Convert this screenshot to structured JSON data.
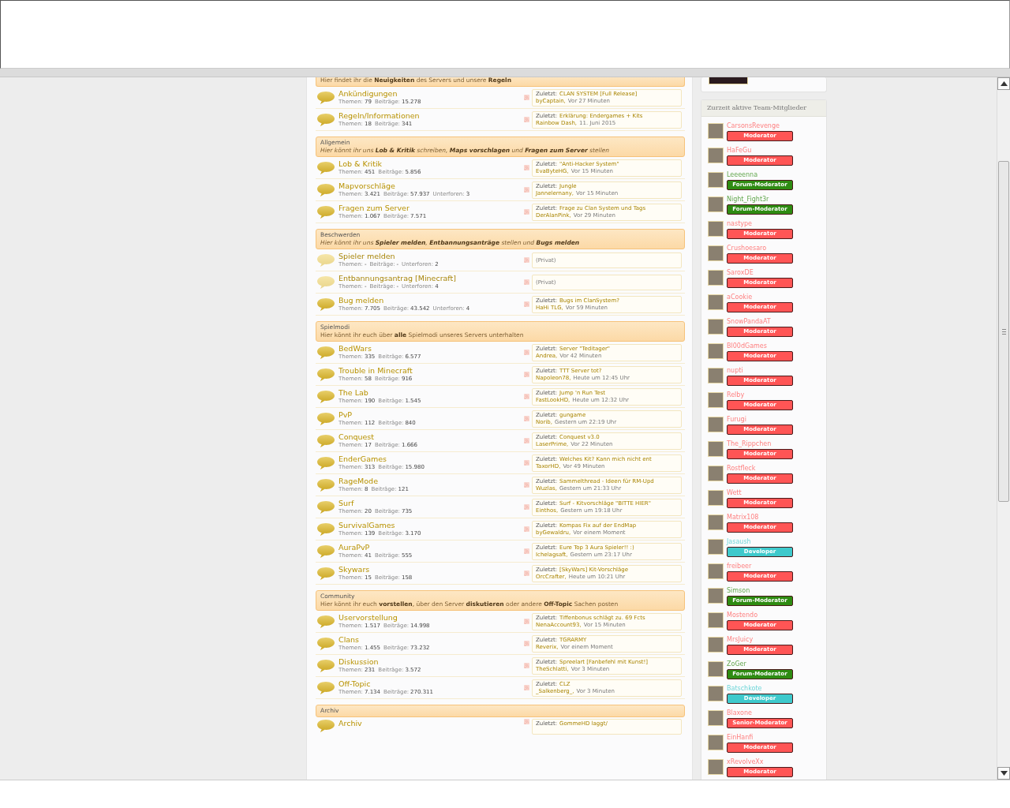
{
  "forum": {
    "sections": [
      {
        "description": "Hier findet ihr die **Neuigkeiten** des Servers und unsere **Regeln**",
        "italic": false,
        "forums": [
          {
            "name": "Ankündigungen",
            "unread": true,
            "stats": [
              {
                "label": "Themen:",
                "value": "79"
              },
              {
                "label": "Beiträge:",
                "value": "15.278"
              }
            ],
            "last": {
              "label": "Zuletzt:",
              "title": "CLAN SYSTEM [Full Release]",
              "author": "byCaptain,",
              "time": "Vor 27 Minuten"
            }
          },
          {
            "name": "Regeln/Informationen",
            "unread": true,
            "stats": [
              {
                "label": "Themen:",
                "value": "18"
              },
              {
                "label": "Beiträge:",
                "value": "341"
              }
            ],
            "last": {
              "label": "Zuletzt:",
              "title": "Erklärung: Endergames + Kits",
              "author": "Rainbow Dash,",
              "time": "11. Juni 2015"
            }
          }
        ]
      },
      {
        "title": "Allgemein",
        "description": "Hier könnt ihr uns **Lob & Kritik** schreiben, **Maps vorschlagen** und **Fragen zum Server** stellen",
        "italic": true,
        "forums": [
          {
            "name": "Lob & Kritik",
            "unread": true,
            "stats": [
              {
                "label": "Themen:",
                "value": "451"
              },
              {
                "label": "Beiträge:",
                "value": "5.856"
              }
            ],
            "last": {
              "label": "Zuletzt:",
              "title": "\"Anti-Hacker System\"",
              "author": "EvaByteHG,",
              "time": "Vor 15 Minuten"
            }
          },
          {
            "name": "Mapvorschläge",
            "unread": true,
            "stats": [
              {
                "label": "Themen:",
                "value": "3.421"
              },
              {
                "label": "Beiträge:",
                "value": "57.937"
              },
              {
                "label": "Unterforen:",
                "value": "3"
              }
            ],
            "last": {
              "label": "Zuletzt:",
              "title": "Jungle",
              "author": "Jannelernany,",
              "time": "Vor 15 Minuten"
            }
          },
          {
            "name": "Fragen zum Server",
            "unread": true,
            "stats": [
              {
                "label": "Themen:",
                "value": "1.067"
              },
              {
                "label": "Beiträge:",
                "value": "7.571"
              }
            ],
            "last": {
              "label": "Zuletzt:",
              "title": "Frage zu Clan System und Tags",
              "author": "DerAlanPink,",
              "time": "Vor 29 Minuten"
            }
          }
        ]
      },
      {
        "title": "Beschwerden",
        "description": "Hier könnt ihr uns **Spieler melden**, **Entbannungsanträge** stellen und **Bugs melden**",
        "italic": true,
        "forums": [
          {
            "name": "Spieler melden",
            "unread": false,
            "stats": [
              {
                "label": "Themen:",
                "value": "-"
              },
              {
                "label": "Beiträge:",
                "value": "-"
              },
              {
                "label": "Unterforen:",
                "value": "2"
              }
            ],
            "last": {
              "private": "(Privat)"
            }
          },
          {
            "name": "Entbannungsantrag [Minecraft]",
            "unread": false,
            "stats": [
              {
                "label": "Themen:",
                "value": "-"
              },
              {
                "label": "Beiträge:",
                "value": "-"
              },
              {
                "label": "Unterforen:",
                "value": "4"
              }
            ],
            "last": {
              "private": "(Privat)"
            }
          },
          {
            "name": "Bug melden",
            "unread": true,
            "stats": [
              {
                "label": "Themen:",
                "value": "7.705"
              },
              {
                "label": "Beiträge:",
                "value": "43.542"
              },
              {
                "label": "Unterforen:",
                "value": "4"
              }
            ],
            "last": {
              "label": "Zuletzt:",
              "title": "Bugs im ClanSystem?",
              "author": "HaHi TLG,",
              "time": "Vor 59 Minuten"
            }
          }
        ]
      },
      {
        "title": "Spielmodi",
        "description": "Hier könnt ihr euch über **alle** Spielmodi unseres Servers unterhalten",
        "italic": false,
        "forums": [
          {
            "name": "BedWars",
            "unread": true,
            "stats": [
              {
                "label": "Themen:",
                "value": "335"
              },
              {
                "label": "Beiträge:",
                "value": "6.577"
              }
            ],
            "last": {
              "label": "Zuletzt:",
              "title": "Server \"Teditager\"",
              "author": "Andrea,",
              "time": "Vor 42 Minuten"
            }
          },
          {
            "name": "Trouble in Minecraft",
            "unread": true,
            "stats": [
              {
                "label": "Themen:",
                "value": "58"
              },
              {
                "label": "Beiträge:",
                "value": "916"
              }
            ],
            "last": {
              "label": "Zuletzt:",
              "title": "TTT Server tot?",
              "author": "Napoleon78,",
              "time": "Heute um 12:45 Uhr"
            }
          },
          {
            "name": "The Lab",
            "unread": true,
            "stats": [
              {
                "label": "Themen:",
                "value": "190"
              },
              {
                "label": "Beiträge:",
                "value": "1.545"
              }
            ],
            "last": {
              "label": "Zuletzt:",
              "title": "Jump 'n Run Test",
              "author": "FastLookHD,",
              "time": "Heute um 12:32 Uhr"
            }
          },
          {
            "name": "PvP",
            "unread": true,
            "stats": [
              {
                "label": "Themen:",
                "value": "112"
              },
              {
                "label": "Beiträge:",
                "value": "840"
              }
            ],
            "last": {
              "label": "Zuletzt:",
              "title": "gungame",
              "author": "Norib,",
              "time": "Gestern um 22:19 Uhr"
            }
          },
          {
            "name": "Conquest",
            "unread": true,
            "stats": [
              {
                "label": "Themen:",
                "value": "17"
              },
              {
                "label": "Beiträge:",
                "value": "1.666"
              }
            ],
            "last": {
              "label": "Zuletzt:",
              "title": "Conquest v3.0",
              "author": "LaserPrime,",
              "time": "Vor 22 Minuten"
            }
          },
          {
            "name": "EnderGames",
            "unread": true,
            "stats": [
              {
                "label": "Themen:",
                "value": "313"
              },
              {
                "label": "Beiträge:",
                "value": "15.980"
              }
            ],
            "last": {
              "label": "Zuletzt:",
              "title": "Welches Kit? Kann mich nicht ent",
              "author": "TaxorHD,",
              "time": "Vor 49 Minuten"
            }
          },
          {
            "name": "RageMode",
            "unread": true,
            "stats": [
              {
                "label": "Themen:",
                "value": "8"
              },
              {
                "label": "Beiträge:",
                "value": "121"
              }
            ],
            "last": {
              "label": "Zuletzt:",
              "title": "Sammelthread - Ideen für RM-Upd",
              "author": "Wuzlas,",
              "time": "Gestern um 21:33 Uhr"
            }
          },
          {
            "name": "Surf",
            "unread": true,
            "stats": [
              {
                "label": "Themen:",
                "value": "20"
              },
              {
                "label": "Beiträge:",
                "value": "735"
              }
            ],
            "last": {
              "label": "Zuletzt:",
              "title": "Surf - Kitvorschläge \"BITTE HIER\"",
              "author": "Einthos,",
              "time": "Gestern um 19:18 Uhr"
            }
          },
          {
            "name": "SurvivalGames",
            "unread": true,
            "stats": [
              {
                "label": "Themen:",
                "value": "139"
              },
              {
                "label": "Beiträge:",
                "value": "3.170"
              }
            ],
            "last": {
              "label": "Zuletzt:",
              "title": "Kompas Fix auf der EndMap",
              "author": "byGewaldru,",
              "time": "Vor einem Moment"
            }
          },
          {
            "name": "AuraPvP",
            "unread": true,
            "stats": [
              {
                "label": "Themen:",
                "value": "41"
              },
              {
                "label": "Beiträge:",
                "value": "555"
              }
            ],
            "last": {
              "label": "Zuletzt:",
              "title": "Eure Top 3 Aura Spieler!! :)",
              "author": "Ichelagsaft,",
              "time": "Gestern um 23:17 Uhr"
            }
          },
          {
            "name": "Skywars",
            "unread": true,
            "stats": [
              {
                "label": "Themen:",
                "value": "15"
              },
              {
                "label": "Beiträge:",
                "value": "158"
              }
            ],
            "last": {
              "label": "Zuletzt:",
              "title": "[SkyWars] Kit-Vorschläge",
              "author": "OrcCrafter,",
              "time": "Heute um 10:21 Uhr"
            }
          }
        ]
      },
      {
        "title": "Community",
        "description": "Hier könnt ihr euch **vorstellen**, über den Server **diskutieren** oder andere **Off-Topic** Sachen posten",
        "italic": false,
        "forums": [
          {
            "name": "Uservorstellung",
            "unread": true,
            "stats": [
              {
                "label": "Themen:",
                "value": "1.517"
              },
              {
                "label": "Beiträge:",
                "value": "14.998"
              }
            ],
            "last": {
              "label": "Zuletzt:",
              "title": "Tiffenbonus schlägt zu. 69 Fcts",
              "author": "NenaAccount93,",
              "time": "Vor 15 Minuten"
            }
          },
          {
            "name": "Clans",
            "unread": true,
            "stats": [
              {
                "label": "Themen:",
                "value": "1.455"
              },
              {
                "label": "Beiträge:",
                "value": "73.232"
              }
            ],
            "last": {
              "label": "Zuletzt:",
              "title": "TGRARMY",
              "author": "Reverix,",
              "time": "Vor einem Moment"
            }
          },
          {
            "name": "Diskussion",
            "unread": true,
            "stats": [
              {
                "label": "Themen:",
                "value": "231"
              },
              {
                "label": "Beiträge:",
                "value": "3.572"
              }
            ],
            "last": {
              "label": "Zuletzt:",
              "title": "Spreelart [Fanbefehl mit Kunst!]",
              "author": "TheSchlatti,",
              "time": "Vor 3 Minuten"
            }
          },
          {
            "name": "Off-Topic",
            "unread": true,
            "stats": [
              {
                "label": "Themen:",
                "value": "7.134"
              },
              {
                "label": "Beiträge:",
                "value": "270.311"
              }
            ],
            "last": {
              "label": "Zuletzt:",
              "title": "CLZ",
              "author": "_Salkenberg_,",
              "time": "Vor 3 Minuten"
            }
          }
        ]
      },
      {
        "title": "Archiv",
        "forums": [
          {
            "name": "Archiv",
            "unread": true,
            "last": {
              "label": "Zuletzt:",
              "title": "GommeHD laggt/"
            }
          }
        ]
      }
    ]
  },
  "sidebar": {
    "team_title": "Zurzeit aktive Team-Mitglieder",
    "members": [
      {
        "name": "CarsonsRevenge",
        "rank": "Moderator",
        "color": "#ff5555"
      },
      {
        "name": "HaFeGu",
        "rank": "Moderator",
        "color": "#ff5555"
      },
      {
        "name": "Leeeenna",
        "rank": "Forum-Moderator",
        "color": "#2e8b12"
      },
      {
        "name": "Night_Fight3r",
        "rank": "Forum-Moderator",
        "color": "#2e8b12"
      },
      {
        "name": "nastype",
        "rank": "Moderator",
        "color": "#ff5555"
      },
      {
        "name": "Crushoesaro",
        "rank": "Moderator",
        "color": "#ff5555"
      },
      {
        "name": "SaroxDE",
        "rank": "Moderator",
        "color": "#ff5555"
      },
      {
        "name": "aCookie",
        "rank": "Moderator",
        "color": "#ff5555"
      },
      {
        "name": "SnowPandaAT",
        "rank": "Moderator",
        "color": "#ff5555"
      },
      {
        "name": "Bl00dGames",
        "rank": "Moderator",
        "color": "#ff5555"
      },
      {
        "name": "nupti",
        "rank": "Moderator",
        "color": "#ff5555"
      },
      {
        "name": "Relby",
        "rank": "Moderator",
        "color": "#ff5555"
      },
      {
        "name": "Furugi",
        "rank": "Moderator",
        "color": "#ff5555"
      },
      {
        "name": "The_Rippchen",
        "rank": "Moderator",
        "color": "#ff5555"
      },
      {
        "name": "Rostfleck",
        "rank": "Moderator",
        "color": "#ff5555"
      },
      {
        "name": "Wett",
        "rank": "Moderator",
        "color": "#ff5555"
      },
      {
        "name": "Matrix108",
        "rank": "Moderator",
        "color": "#ff5555"
      },
      {
        "name": "Jasaush",
        "rank": "Developer",
        "color": "#3ec9cc"
      },
      {
        "name": "freibeer",
        "rank": "Moderator",
        "color": "#ff5555"
      },
      {
        "name": "Simson",
        "rank": "Forum-Moderator",
        "color": "#2e8b12"
      },
      {
        "name": "Mostendo",
        "rank": "Moderator",
        "color": "#ff5555"
      },
      {
        "name": "MrsJuicy",
        "rank": "Moderator",
        "color": "#ff5555"
      },
      {
        "name": "ZoGer",
        "rank": "Forum-Moderator",
        "color": "#2e8b12"
      },
      {
        "name": "Batschkote",
        "rank": "Developer",
        "color": "#3ec9cc"
      },
      {
        "name": "Blaxone",
        "rank": "Senior-Moderator",
        "color": "#ff5555"
      },
      {
        "name": "EinHanfi",
        "rank": "Moderator",
        "color": "#ff5555"
      },
      {
        "name": "xRevolveXx",
        "rank": "Moderator",
        "color": "#ff5555"
      }
    ]
  }
}
